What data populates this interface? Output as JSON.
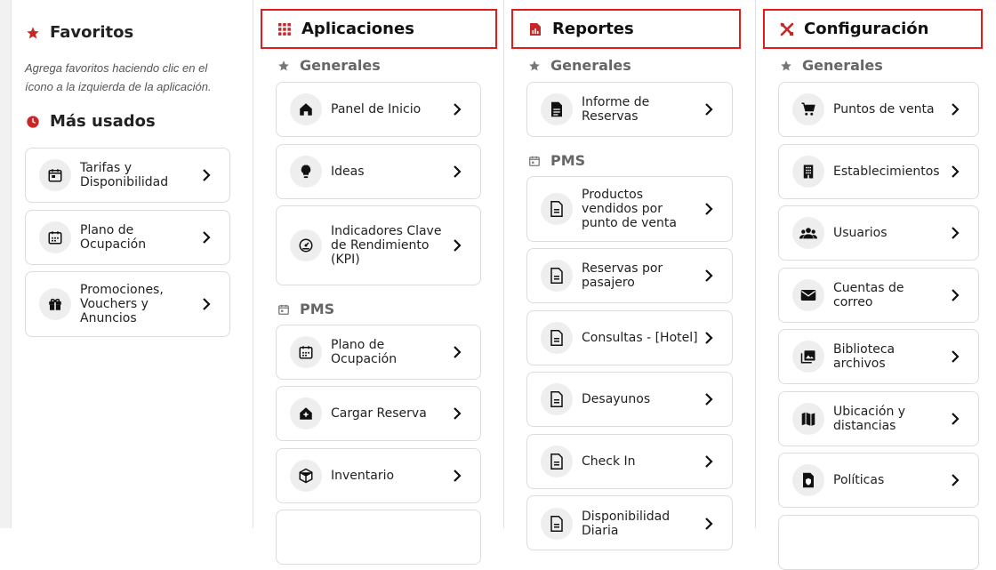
{
  "sidebar": {
    "favoritos_title": "Favoritos",
    "favoritos_hint": "Agrega favoritos haciendo clic en el ícono a la izquierda de la aplicación.",
    "mas_usados_title": "Más usados",
    "items": [
      {
        "label": "Tarifas y Disponibilidad",
        "icon": "calendar-icon"
      },
      {
        "label": "Plano de Ocupación",
        "icon": "calendar-grid-icon"
      },
      {
        "label": "Promociones, Vouchers y Anuncios",
        "icon": "gift-icon"
      }
    ]
  },
  "aplicaciones": {
    "title": "Aplicaciones",
    "icon": "apps-grid-icon",
    "group_generales": "Generales",
    "group_pms": "PMS",
    "generales_items": [
      {
        "label": "Panel de Inicio",
        "icon": "home-icon"
      },
      {
        "label": "Ideas",
        "icon": "lightbulb-icon"
      },
      {
        "label": "Indicadores Clave de Rendimiento (KPI)",
        "icon": "gauge-icon"
      }
    ],
    "pms_items": [
      {
        "label": "Plano de Ocupación",
        "icon": "calendar-grid-icon"
      },
      {
        "label": "Cargar Reserva",
        "icon": "house-add-icon"
      },
      {
        "label": "Inventario",
        "icon": "box-icon"
      }
    ]
  },
  "reportes": {
    "title": "Reportes",
    "icon": "report-icon",
    "group_generales": "Generales",
    "group_pms": "PMS",
    "generales_items": [
      {
        "label": "Informe de Reservas",
        "icon": "document-icon"
      }
    ],
    "pms_items": [
      {
        "label": "Productos vendidos por punto de venta",
        "icon": "document-outline-icon"
      },
      {
        "label": "Reservas por pasajero",
        "icon": "document-outline-icon"
      },
      {
        "label": "Consultas - [Hotel]",
        "icon": "document-outline-icon"
      },
      {
        "label": "Desayunos",
        "icon": "document-outline-icon"
      },
      {
        "label": "Check In",
        "icon": "document-outline-icon"
      },
      {
        "label": "Disponibilidad Diaria",
        "icon": "document-outline-icon"
      }
    ]
  },
  "configuracion": {
    "title": "Configuración",
    "icon": "tools-icon",
    "group_generales": "Generales",
    "generales_items": [
      {
        "label": "Puntos de venta",
        "icon": "cart-icon"
      },
      {
        "label": "Establecimientos",
        "icon": "building-icon"
      },
      {
        "label": "Usuarios",
        "icon": "users-icon"
      },
      {
        "label": "Cuentas de correo",
        "icon": "mail-icon"
      },
      {
        "label": "Biblioteca archivos",
        "icon": "photo-library-icon"
      },
      {
        "label": "Ubicación y distancias",
        "icon": "map-icon"
      },
      {
        "label": "Políticas",
        "icon": "policy-icon"
      }
    ]
  },
  "colors": {
    "accent": "#c62828",
    "highlight_border": "#e01c1c",
    "muted": "#666666"
  }
}
